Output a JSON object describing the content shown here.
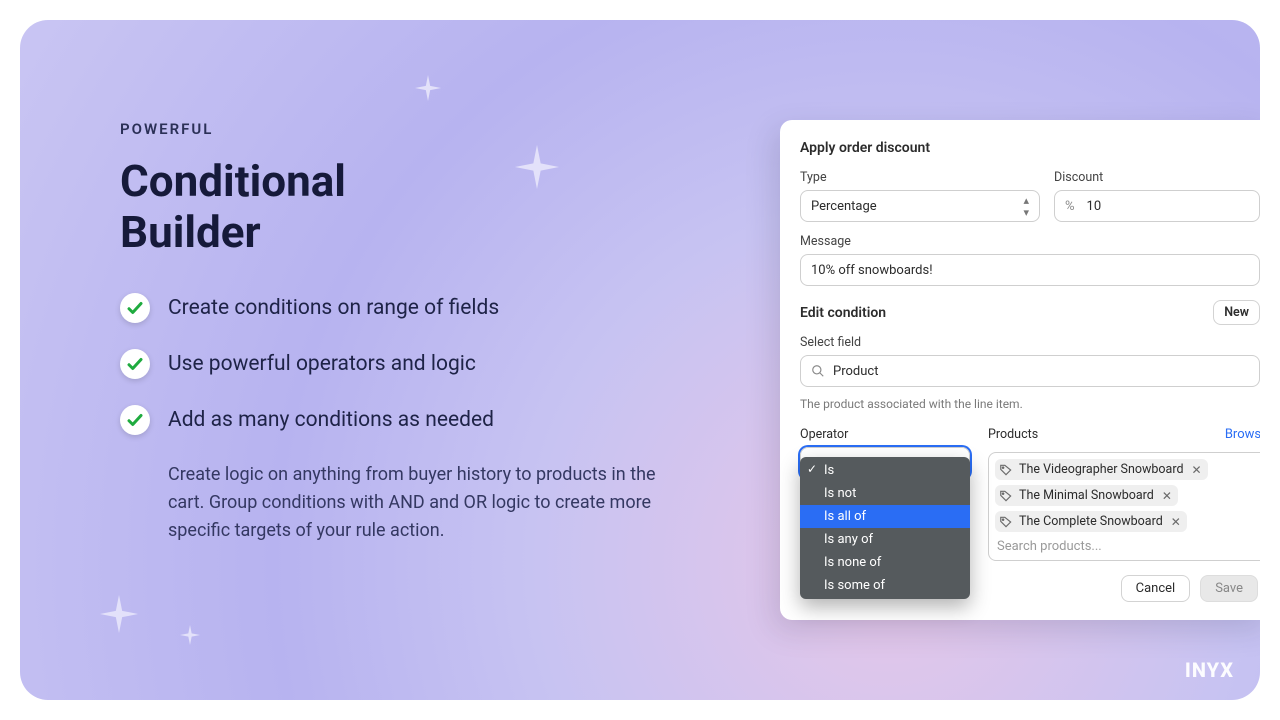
{
  "marketing": {
    "eyebrow": "POWERFUL",
    "title_line1": "Conditional",
    "title_line2": "Builder",
    "bullets": [
      "Create conditions on range of fields",
      "Use powerful operators and logic",
      "Add as many conditions as needed"
    ],
    "description": "Create logic on anything from buyer history to products in the cart. Group conditions with AND and OR logic to create more specific targets of your rule action."
  },
  "panel": {
    "title": "Apply order discount",
    "type_label": "Type",
    "type_value": "Percentage",
    "discount_label": "Discount",
    "discount_prefix": "%",
    "discount_value": "10",
    "message_label": "Message",
    "message_value": "10% off snowboards!",
    "edit_condition_label": "Edit condition",
    "new_button": "New",
    "select_field_label": "Select field",
    "select_field_value": "Product",
    "select_field_hint": "The product associated with the line item.",
    "operator_label": "Operator",
    "operator_options": [
      "Is",
      "Is not",
      "Is all of",
      "Is any of",
      "Is none of",
      "Is some of"
    ],
    "operator_selected": "Is",
    "operator_highlighted": "Is all of",
    "products_label": "Products",
    "browse_label": "Browse",
    "product_chips": [
      "The Videographer Snowboard",
      "The Minimal Snowboard",
      "The Complete Snowboard"
    ],
    "product_search_placeholder": "Search products...",
    "cancel": "Cancel",
    "save": "Save"
  },
  "brand": "INYX"
}
